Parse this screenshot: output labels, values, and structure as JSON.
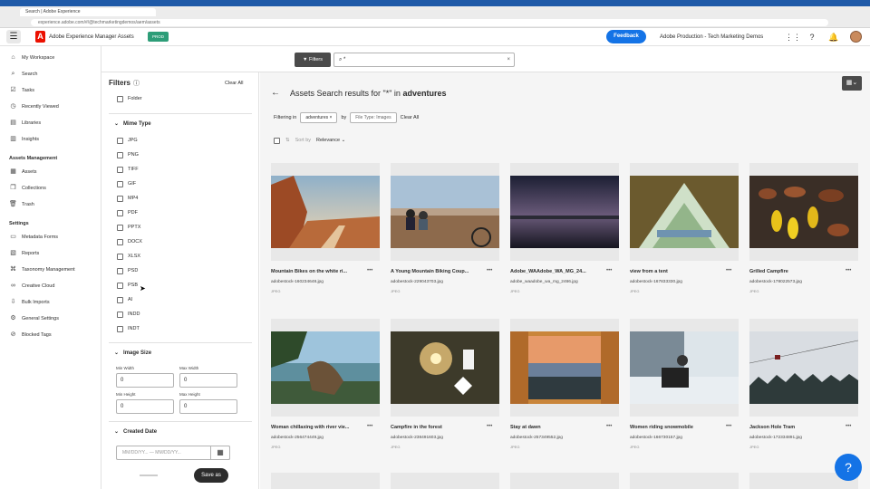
{
  "browser": {
    "tab_title": "Search | Adobe Experience",
    "url": "experience.adobe.com/#/@techmarketingdemos/aem/assets"
  },
  "header": {
    "app_title": "Adobe Experience Manager Assets",
    "env_badge": "PROD",
    "feedback_label": "Feedback",
    "org_name": "Adobe Production - Tech Marketing Demos"
  },
  "nav": {
    "top_items": [
      {
        "label": "My Workspace",
        "icon": "home-icon"
      },
      {
        "label": "Search",
        "icon": "search-icon"
      },
      {
        "label": "Tasks",
        "icon": "tasks-icon"
      },
      {
        "label": "Recently Viewed",
        "icon": "clock-icon"
      },
      {
        "label": "Libraries",
        "icon": "library-icon"
      },
      {
        "label": "Insights",
        "icon": "chart-icon"
      }
    ],
    "assets_section": "Assets Management",
    "assets_items": [
      {
        "label": "Assets",
        "icon": "assets-icon"
      },
      {
        "label": "Collections",
        "icon": "collections-icon"
      },
      {
        "label": "Trash",
        "icon": "trash-icon"
      }
    ],
    "settings_section": "Settings",
    "settings_items": [
      {
        "label": "Metadata Forms",
        "icon": "form-icon"
      },
      {
        "label": "Reports",
        "icon": "report-icon"
      },
      {
        "label": "Taxonomy Management",
        "icon": "taxonomy-icon"
      },
      {
        "label": "Creative Cloud",
        "icon": "cc-icon"
      },
      {
        "label": "Bulk Imports",
        "icon": "import-icon"
      },
      {
        "label": "General Settings",
        "icon": "gear-icon"
      },
      {
        "label": "Blocked Tags",
        "icon": "tag-icon"
      }
    ]
  },
  "search": {
    "filters_label": "Filters",
    "query": "*"
  },
  "filters": {
    "title": "Filters",
    "clear_all": "Clear All",
    "folder_label": "Folder",
    "mime_section": "Mime Type",
    "mime_types": [
      "JPG",
      "PNG",
      "TIFF",
      "GIF",
      "MP4",
      "PDF",
      "PPTX",
      "DOCX",
      "XLSX",
      "PSD",
      "PSB",
      "AI",
      "INDD",
      "INDT"
    ],
    "image_size_section": "Image Size",
    "min_width_label": "Min Width",
    "max_width_label": "Max Width",
    "min_height_label": "Min Height",
    "max_height_label": "Max Height",
    "min_width": "0",
    "max_width": "0",
    "min_height": "0",
    "max_height": "0",
    "created_date_section": "Created Date",
    "date_placeholder": "MM/DD/YY... — MM/DD/YY...",
    "save_as": "Save as"
  },
  "results": {
    "title_prefix": "Assets Search results for \"*\" in",
    "folder": "adventures",
    "filtering_in": "Filtering in",
    "chip_folder": "adventures ×",
    "by": "by",
    "chip_type": "File Type: Images",
    "clear_all": "Clear All",
    "sort_by": "Sort by",
    "sort_value": "Relevance",
    "assets": [
      {
        "title": "Mountain Bikes on the white ri...",
        "file": "adobestock-160234648.jpg",
        "type": "JPEG"
      },
      {
        "title": "A Young Mountain Biking Coup...",
        "file": "adobestock-229043703.jpg",
        "type": "JPEG"
      },
      {
        "title": "Adobe_WAAdobe_WA_MG_24...",
        "file": "adobe_waadobe_wa_mg_2466.jpg",
        "type": "JPEG"
      },
      {
        "title": "view from a tent",
        "file": "adobestock-167833330.jpg",
        "type": "JPEG"
      },
      {
        "title": "Grilled Campfire",
        "file": "adobestock-178022573.jpg",
        "type": "JPEG"
      },
      {
        "title": "Woman chillaxing with river vie...",
        "file": "adobestock-256474449.jpg",
        "type": "JPEG"
      },
      {
        "title": "Campfire in the forest",
        "file": "adobestock-238491603.jpg",
        "type": "JPEG"
      },
      {
        "title": "Stay at dawn",
        "file": "adobestock-257349552.jpg",
        "type": "JPEG"
      },
      {
        "title": "Women riding snowmobile",
        "file": "adobestock-166730157.jpg",
        "type": "JPEG"
      },
      {
        "title": "Jackson Hole Tram",
        "file": "adobestock-172334891.jpg",
        "type": "JPEG"
      }
    ]
  }
}
